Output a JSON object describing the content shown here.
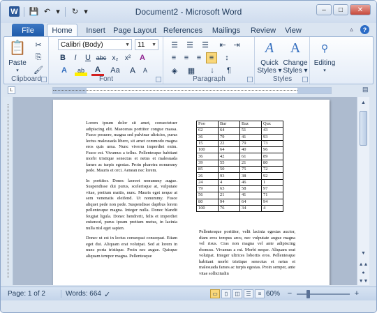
{
  "window": {
    "title": "Document2 - Microsoft Word",
    "word_logo": "W",
    "buttons": {
      "minimize": "–",
      "maximize": "□",
      "close": "✕"
    }
  },
  "qat": {
    "save": "💾",
    "undo": "↶",
    "undo_drop": "▾",
    "redo": "↻",
    "customize": "▾"
  },
  "tabs": [
    {
      "label": "File"
    },
    {
      "label": "Home"
    },
    {
      "label": "Insert"
    },
    {
      "label": "Page Layout"
    },
    {
      "label": "References"
    },
    {
      "label": "Mailings"
    },
    {
      "label": "Review"
    },
    {
      "label": "View"
    }
  ],
  "ribbon": {
    "clipboard": {
      "label": "Clipboard",
      "paste": "Paste",
      "cut": "✂",
      "copy": "⎘",
      "format_painter": "🖌"
    },
    "font": {
      "label": "Font",
      "font_name": "Calibri (Body)",
      "font_size": "11",
      "bold": "B",
      "italic": "I",
      "underline": "U",
      "strike": "abc",
      "subscript": "x₂",
      "superscript": "x²",
      "grow": "A",
      "shrink": "A",
      "clear": "A",
      "effects": "A",
      "highlight": "ab",
      "color": "A",
      "case": "Aa",
      "grow2": "A",
      "shrink2": "A"
    },
    "paragraph": {
      "label": "Paragraph",
      "bullets": "☰",
      "numbering": "☰",
      "multilevel": "☰",
      "dec_indent": "⇤",
      "inc_indent": "⇥",
      "align_left": "≡",
      "center": "≡",
      "align_right": "≡",
      "justify": "≡",
      "line_spacing": "↕",
      "shading": "◈",
      "borders": "▦",
      "sort": "↓",
      "pilcrow": "¶"
    },
    "styles": {
      "label": "Styles",
      "quick": "Quick",
      "quick2": "Styles ▾",
      "change": "Change",
      "change2": "Styles ▾"
    },
    "editing": {
      "label": "Editing"
    }
  },
  "document": {
    "column1": [
      "Lorem ipsum dolor sit amet, consectetuer adipiscing elit. Maecenas porttitor congue massa. Fusce posuere, magna sed pulvinar ultricies, purus lectus malesuada libero, sit amet commodo magna eros quis urna. Nunc viverra imperdiet enim. Fusce est. Vivamus a tellus. Pellentesque habitant morbi tristique senectus et netus et malesuada fames ac turpis egestas. Proin pharetra nonummy pede. Mauris et orci. Aenean nec lorem.",
      "In porttitor. Donec laoreet nonummy augue. Suspendisse dui purus, scelerisque at, vulputate vitae, pretium mattis, nunc. Mauris eget neque at sem venenatis eleifend. Ut nonummy. Fusce aliquet pede non pede. Suspendisse dapibus lorem pellentesque magna. Integer nulla. Donec blandit feugiat ligula. Donec hendrerit, felis et imperdiet euismod, purus ipsum pretium metus, in lacinia nulla nisl eget sapien.",
      "Donec ut est in lectus consequat consequat. Etiam eget dui. Aliquam erat volutpat. Sed at lorem in nunc porta tristique. Proin nec augue. Quisque aliquam tempor magna. Pellentesque"
    ],
    "column2": "Pellentesque porttitor, velit lacinia egestas auctor, diam eros tempus arcu, nec vulputate augue magna vel risus. Cras non magna vel ante adipiscing rhoncus. Vivamus a mi. Morbi neque. Aliquam erat volutpat. Integer ultrices lobortis eros. Pellentesque habitant morbi tristique senectus et netus et malesuada fames ac turpis egestas. Proin semper, ante vitae sollicitudin",
    "table": {
      "headers": [
        "Foo",
        "Bar",
        "Baz",
        "Qux"
      ],
      "rows": [
        [
          "62",
          "64",
          "51",
          "43"
        ],
        [
          "36",
          "79",
          "41",
          "93"
        ],
        [
          "15",
          "22",
          "79",
          "73"
        ],
        [
          "100",
          "64",
          "40",
          "96"
        ],
        [
          "36",
          "42",
          "61",
          "89"
        ],
        [
          "39",
          "55",
          "21",
          "80"
        ],
        [
          "85",
          "50",
          "75",
          "72"
        ],
        [
          "26",
          "93",
          "38",
          "92"
        ],
        [
          "24",
          "4",
          "46",
          "1"
        ],
        [
          "79",
          "63",
          "58",
          "97"
        ],
        [
          "56",
          "21",
          "41",
          "71"
        ],
        [
          "80",
          "94",
          "64",
          "94"
        ],
        [
          "100",
          "76",
          "34",
          "4"
        ]
      ]
    }
  },
  "status": {
    "page": "Page: 1 of 2",
    "words": "Words: 664",
    "zoom": "60%",
    "zoom_out": "−",
    "zoom_in": "+"
  }
}
